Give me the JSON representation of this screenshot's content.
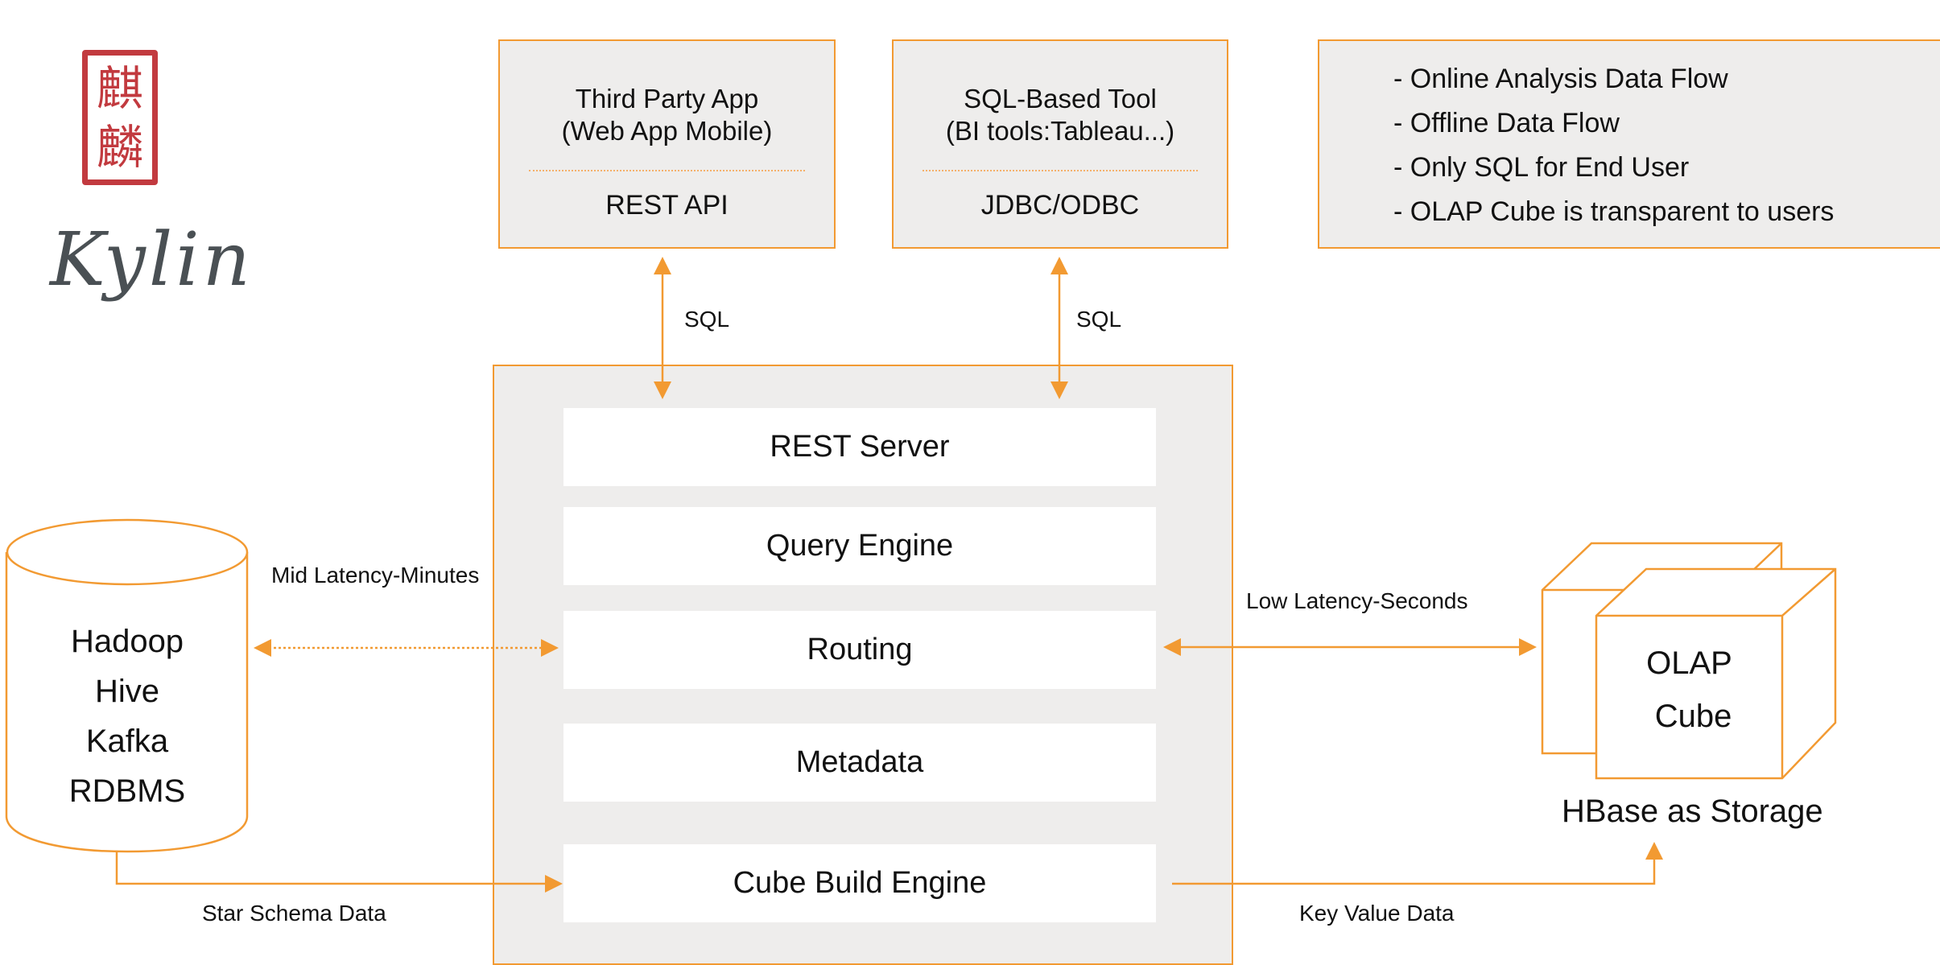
{
  "logo": {
    "seal_chars": [
      "麒",
      "麟"
    ],
    "wordmark": "Kylin",
    "seal_color": "#c23a3f",
    "wordmark_color": "#4a5054"
  },
  "colors": {
    "accent": "#f29a32",
    "panel_bg": "#eeedec",
    "inner_bg": "#ffffff",
    "text": "#111111"
  },
  "clients": [
    {
      "title_line1": "Third Party App",
      "title_line2": "(Web App Mobile)",
      "protocol": "REST API",
      "link_label": "SQL"
    },
    {
      "title_line1": "SQL-Based Tool",
      "title_line2": "(BI tools:Tableau...)",
      "protocol": "JDBC/ODBC",
      "link_label": "SQL"
    }
  ],
  "legend": {
    "items": [
      "- Online Analysis Data Flow",
      "- Offline Data Flow",
      "- Only SQL for End User",
      "- OLAP Cube is transparent to users"
    ]
  },
  "kylin_server": {
    "components": [
      "REST Server",
      "Query Engine",
      "Routing",
      "Metadata",
      "Cube Build Engine"
    ]
  },
  "data_source": {
    "lines": [
      "Hadoop",
      "Hive",
      "Kafka",
      "RDBMS"
    ]
  },
  "storage": {
    "cube_line1": "OLAP",
    "cube_line2": "Cube",
    "caption": "HBase as Storage"
  },
  "flows": {
    "mid_latency": "Mid Latency-Minutes",
    "low_latency": "Low Latency-Seconds",
    "star_schema": "Star Schema Data",
    "key_value": "Key Value Data"
  }
}
